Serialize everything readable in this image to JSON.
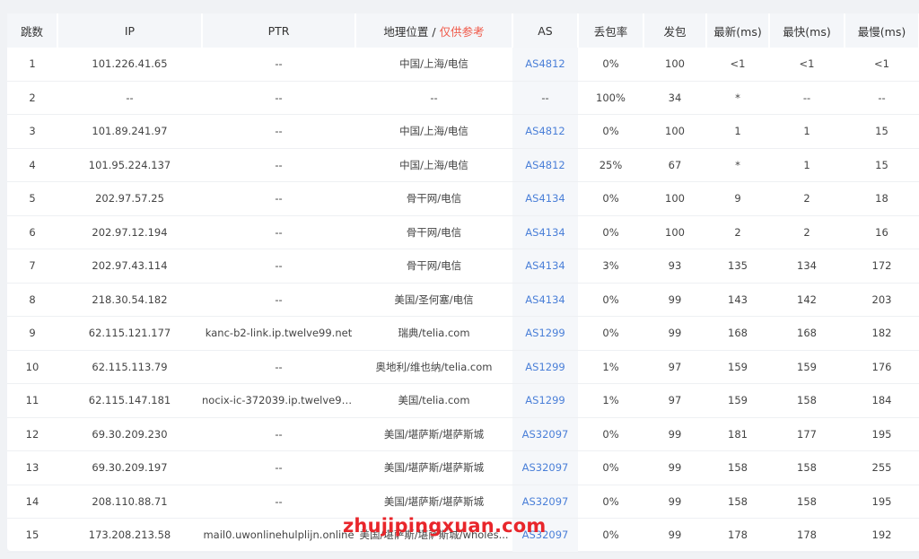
{
  "columns": {
    "hop": "跳数",
    "ip": "IP",
    "ptr": "PTR",
    "geo": "地理位置",
    "geo_sep": " / ",
    "geo_note": "仅供参考",
    "as": "AS",
    "loss": "丢包率",
    "sent": "发包",
    "last": "最新(ms)",
    "best": "最快(ms)",
    "worst": "最慢(ms)"
  },
  "rows": [
    {
      "hop": "1",
      "ip": "101.226.41.65",
      "ptr": "--",
      "geo": "中国/上海/电信",
      "as": "AS4812",
      "loss": "0%",
      "sent": "100",
      "last": "<1",
      "best": "<1",
      "worst": "<1"
    },
    {
      "hop": "2",
      "ip": "--",
      "ptr": "--",
      "geo": "--",
      "as": "--",
      "loss": "100%",
      "sent": "34",
      "last": "*",
      "best": "--",
      "worst": "--"
    },
    {
      "hop": "3",
      "ip": "101.89.241.97",
      "ptr": "--",
      "geo": "中国/上海/电信",
      "as": "AS4812",
      "loss": "0%",
      "sent": "100",
      "last": "1",
      "best": "1",
      "worst": "15"
    },
    {
      "hop": "4",
      "ip": "101.95.224.137",
      "ptr": "--",
      "geo": "中国/上海/电信",
      "as": "AS4812",
      "loss": "25%",
      "sent": "67",
      "last": "*",
      "best": "1",
      "worst": "15"
    },
    {
      "hop": "5",
      "ip": "202.97.57.25",
      "ptr": "--",
      "geo": "骨干网/电信",
      "as": "AS4134",
      "loss": "0%",
      "sent": "100",
      "last": "9",
      "best": "2",
      "worst": "18"
    },
    {
      "hop": "6",
      "ip": "202.97.12.194",
      "ptr": "--",
      "geo": "骨干网/电信",
      "as": "AS4134",
      "loss": "0%",
      "sent": "100",
      "last": "2",
      "best": "2",
      "worst": "16"
    },
    {
      "hop": "7",
      "ip": "202.97.43.114",
      "ptr": "--",
      "geo": "骨干网/电信",
      "as": "AS4134",
      "loss": "3%",
      "sent": "93",
      "last": "135",
      "best": "134",
      "worst": "172"
    },
    {
      "hop": "8",
      "ip": "218.30.54.182",
      "ptr": "--",
      "geo": "美国/圣何塞/电信",
      "as": "AS4134",
      "loss": "0%",
      "sent": "99",
      "last": "143",
      "best": "142",
      "worst": "203"
    },
    {
      "hop": "9",
      "ip": "62.115.121.177",
      "ptr": "kanc-b2-link.ip.twelve99.net",
      "geo": "瑞典/telia.com",
      "as": "AS1299",
      "loss": "0%",
      "sent": "99",
      "last": "168",
      "best": "168",
      "worst": "182"
    },
    {
      "hop": "10",
      "ip": "62.115.113.79",
      "ptr": "--",
      "geo": "奥地利/维也纳/telia.com",
      "as": "AS1299",
      "loss": "1%",
      "sent": "97",
      "last": "159",
      "best": "159",
      "worst": "176"
    },
    {
      "hop": "11",
      "ip": "62.115.147.181",
      "ptr": "nocix-ic-372039.ip.twelve99-...",
      "geo": "美国/telia.com",
      "as": "AS1299",
      "loss": "1%",
      "sent": "97",
      "last": "159",
      "best": "158",
      "worst": "184"
    },
    {
      "hop": "12",
      "ip": "69.30.209.230",
      "ptr": "--",
      "geo": "美国/堪萨斯/堪萨斯城",
      "as": "AS32097",
      "loss": "0%",
      "sent": "99",
      "last": "181",
      "best": "177",
      "worst": "195"
    },
    {
      "hop": "13",
      "ip": "69.30.209.197",
      "ptr": "--",
      "geo": "美国/堪萨斯/堪萨斯城",
      "as": "AS32097",
      "loss": "0%",
      "sent": "99",
      "last": "158",
      "best": "158",
      "worst": "255"
    },
    {
      "hop": "14",
      "ip": "208.110.88.71",
      "ptr": "--",
      "geo": "美国/堪萨斯/堪萨斯城",
      "as": "AS32097",
      "loss": "0%",
      "sent": "99",
      "last": "158",
      "best": "158",
      "worst": "195"
    },
    {
      "hop": "15",
      "ip": "173.208.213.58",
      "ptr": "mail0.uwonlinehulplijn.online",
      "geo": "美国/堪萨斯/堪萨斯城/wholes...",
      "as": "AS32097",
      "loss": "0%",
      "sent": "99",
      "last": "178",
      "best": "178",
      "worst": "192"
    }
  ],
  "watermark": "zhujipingxuan.com",
  "colors": {
    "as_link": "#4a7fd8",
    "geo_note": "#f05a4a",
    "watermark": "#e8262b"
  }
}
